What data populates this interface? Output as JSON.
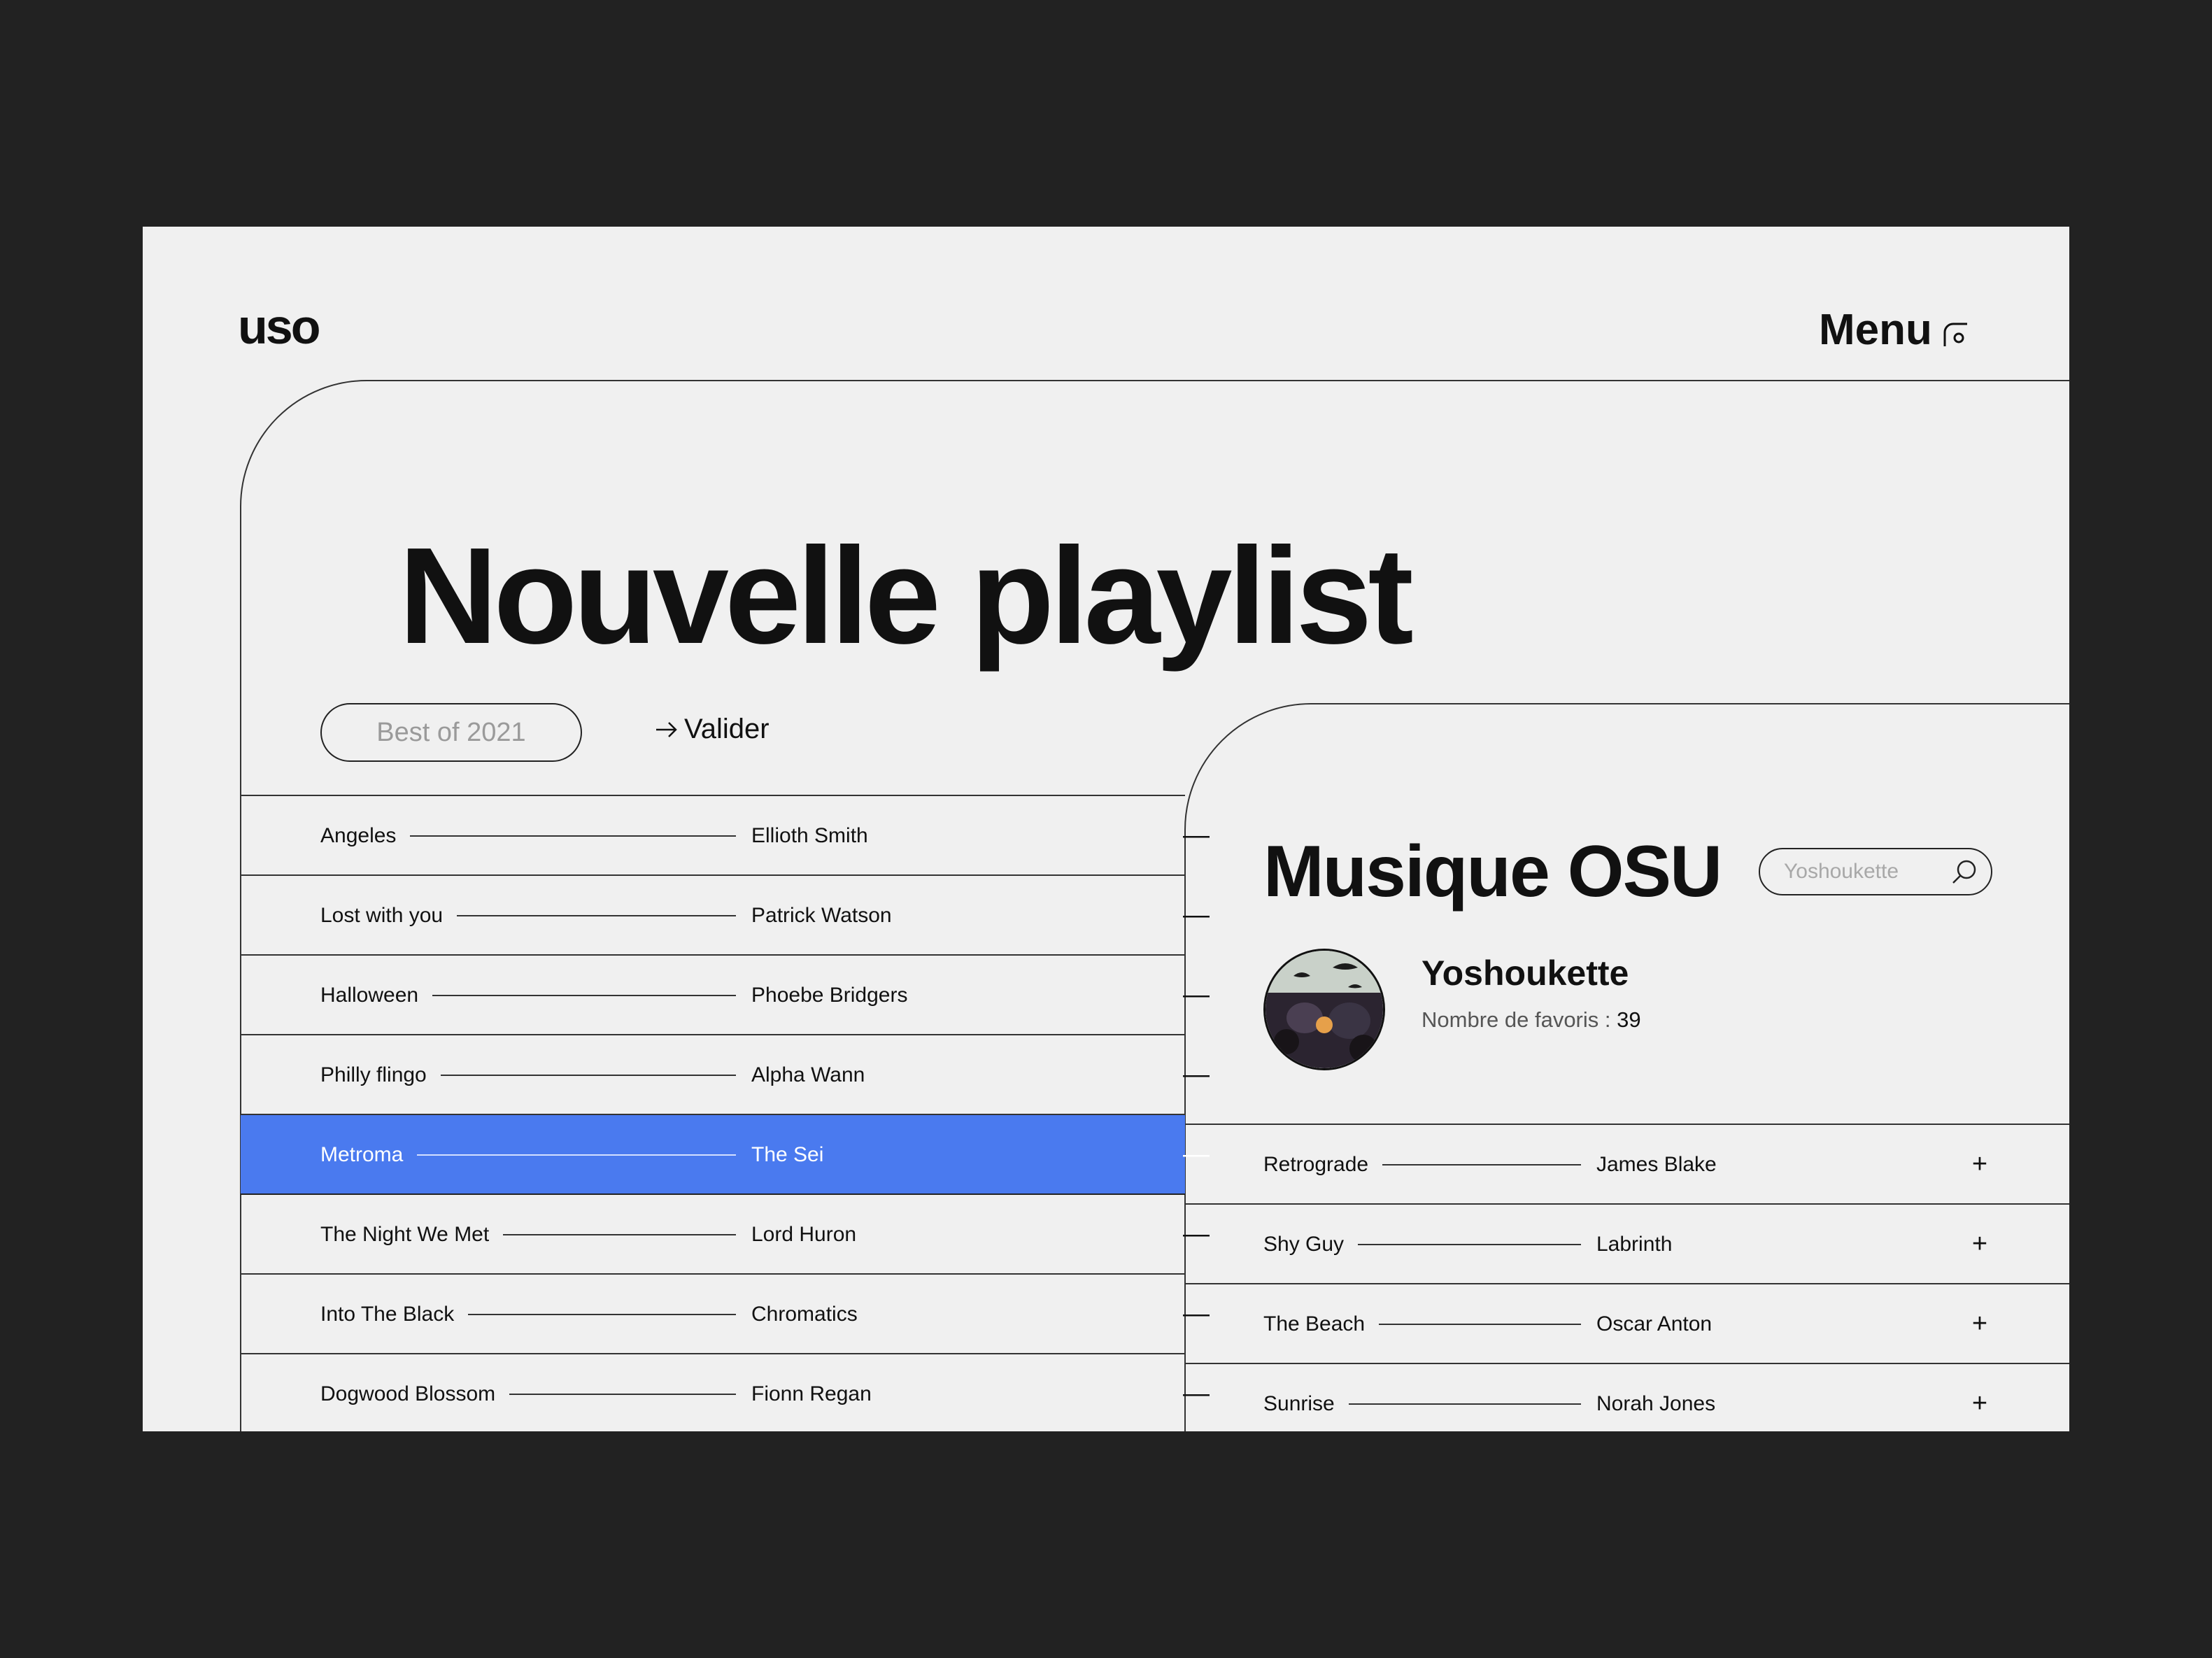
{
  "header": {
    "logo": "uso",
    "menu_label": "Menu",
    "menu_icon": "menu-corner-icon"
  },
  "new_playlist": {
    "title": "Nouvelle playlist",
    "name_input": {
      "value": "",
      "placeholder": "Best of 2021"
    },
    "validate_label": "Valider",
    "validate_icon": "arrow-right-icon",
    "selected_index": 4,
    "action_symbol": "—",
    "tracks": [
      {
        "song": "Angeles",
        "artist": "Ellioth Smith"
      },
      {
        "song": "Lost with you",
        "artist": "Patrick Watson"
      },
      {
        "song": "Halloween",
        "artist": "Phoebe Bridgers"
      },
      {
        "song": "Philly flingo",
        "artist": "Alpha Wann"
      },
      {
        "song": "Metroma",
        "artist": "The Sei"
      },
      {
        "song": "The Night We Met",
        "artist": "Lord Huron"
      },
      {
        "song": "Into The Black",
        "artist": "Chromatics"
      },
      {
        "song": "Dogwood Blossom",
        "artist": "Fionn Regan"
      }
    ]
  },
  "source": {
    "title": "Musique OSU",
    "search": {
      "value": "",
      "placeholder": "Yoshoukette"
    },
    "search_icon": "search-icon",
    "user": {
      "name": "Yoshoukette",
      "favorites_label": "Nombre de favoris : ",
      "favorites_count": "39",
      "avatar": "user-avatar-image"
    },
    "action_symbol": "+",
    "tracks": [
      {
        "song": "Retrograde",
        "artist": "James Blake"
      },
      {
        "song": "Shy Guy",
        "artist": "Labrinth"
      },
      {
        "song": "The Beach",
        "artist": "Oscar Anton"
      },
      {
        "song": "Sunrise",
        "artist": "Norah Jones"
      }
    ]
  },
  "colors": {
    "page_background": "#222222",
    "panel_background": "#f0f0f0",
    "highlight": "#4a7aef",
    "text": "#111111",
    "line": "#333333"
  }
}
